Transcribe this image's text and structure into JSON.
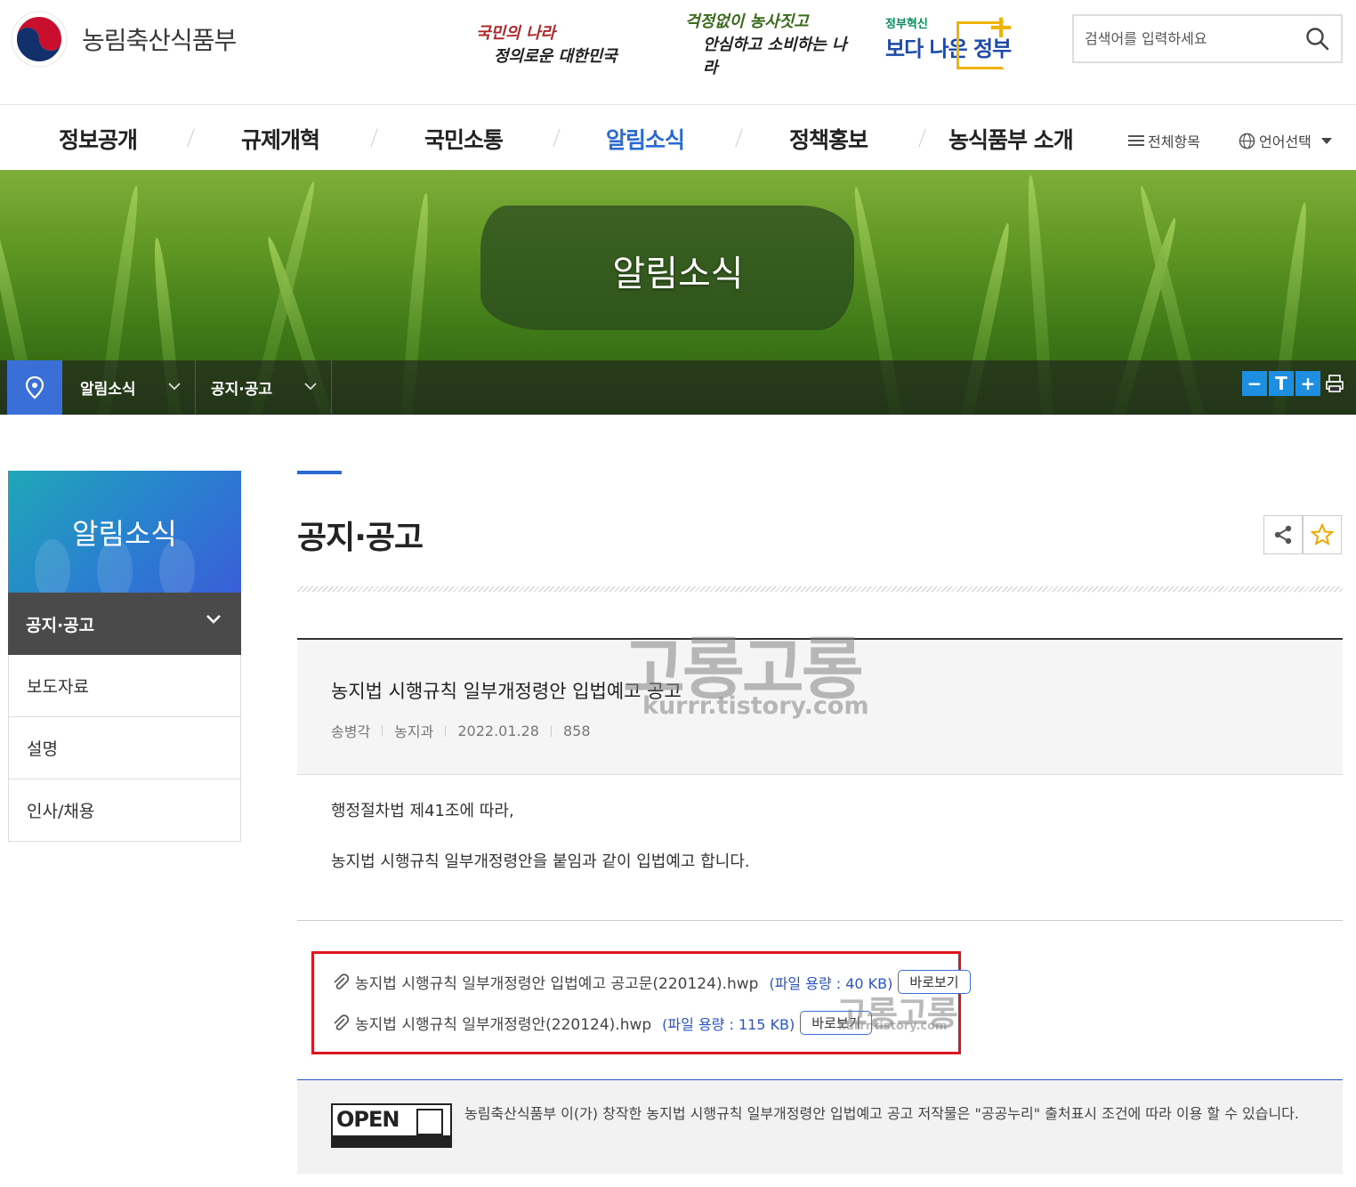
{
  "header": {
    "logo_text": "농림축산식품부",
    "slogan1": {
      "line1": "국민의 나라",
      "line2": "정의로운 대한민국"
    },
    "slogan2": {
      "line1": "걱정없이 농사짓고",
      "line2": "안심하고 소비하는 나라"
    },
    "slogan3": {
      "small": "정부혁신",
      "big": "보다 나은 정부"
    },
    "search_placeholder": "검색어를 입력하세요"
  },
  "nav": {
    "items": [
      "정보공개",
      "규제개혁",
      "국민소통",
      "알림소식",
      "정책홍보",
      "농식품부 소개"
    ],
    "active_index": 3,
    "all_menu": "전체항목",
    "language": "언어선택"
  },
  "banner": {
    "title": "알림소식",
    "location": [
      "알림소식",
      "공지·공고"
    ],
    "tools": [
      "−",
      "T",
      "+"
    ]
  },
  "sidebar": {
    "title": "알림소식",
    "active": "공지·공고",
    "items": [
      "보도자료",
      "설명",
      "인사/채용"
    ]
  },
  "page": {
    "title": "공지·공고"
  },
  "post": {
    "title": "농지법 시행규칙 일부개정령안 입법예고 공고",
    "author": "송병각",
    "department": "농지과",
    "date": "2022.01.28",
    "views": "858",
    "body": [
      "행정절차법 제41조에 따라,",
      "농지법 시행규칙 일부개정령안을 붙임과 같이 입법예고 합니다."
    ],
    "files": [
      {
        "name": "농지법 시행규칙 일부개정령안 입법예고 공고문(220124).hwp",
        "size": "(파일 용량 : 40 KB)",
        "view": "바로보기"
      },
      {
        "name": "농지법 시행규칙 일부개정령안(220124).hwp",
        "size": "(파일 용량 : 115 KB)",
        "view": "바로보기"
      }
    ]
  },
  "license": {
    "badge": "OPEN",
    "text": "농림축산식품부 이(가) 창작한 농지법 시행규칙 일부개정령안 입법예고 공고 저작물은 \"공공누리\" 출처표시 조건에 따라 이용 할 수 있습니다."
  },
  "watermark": {
    "text": "고롱고롱",
    "url": "kurrr.tistory.com"
  },
  "colors": {
    "accent": "#2a6ad5",
    "highlight_box": "#e0161e",
    "sidebar_active": "#4a4a4a"
  }
}
